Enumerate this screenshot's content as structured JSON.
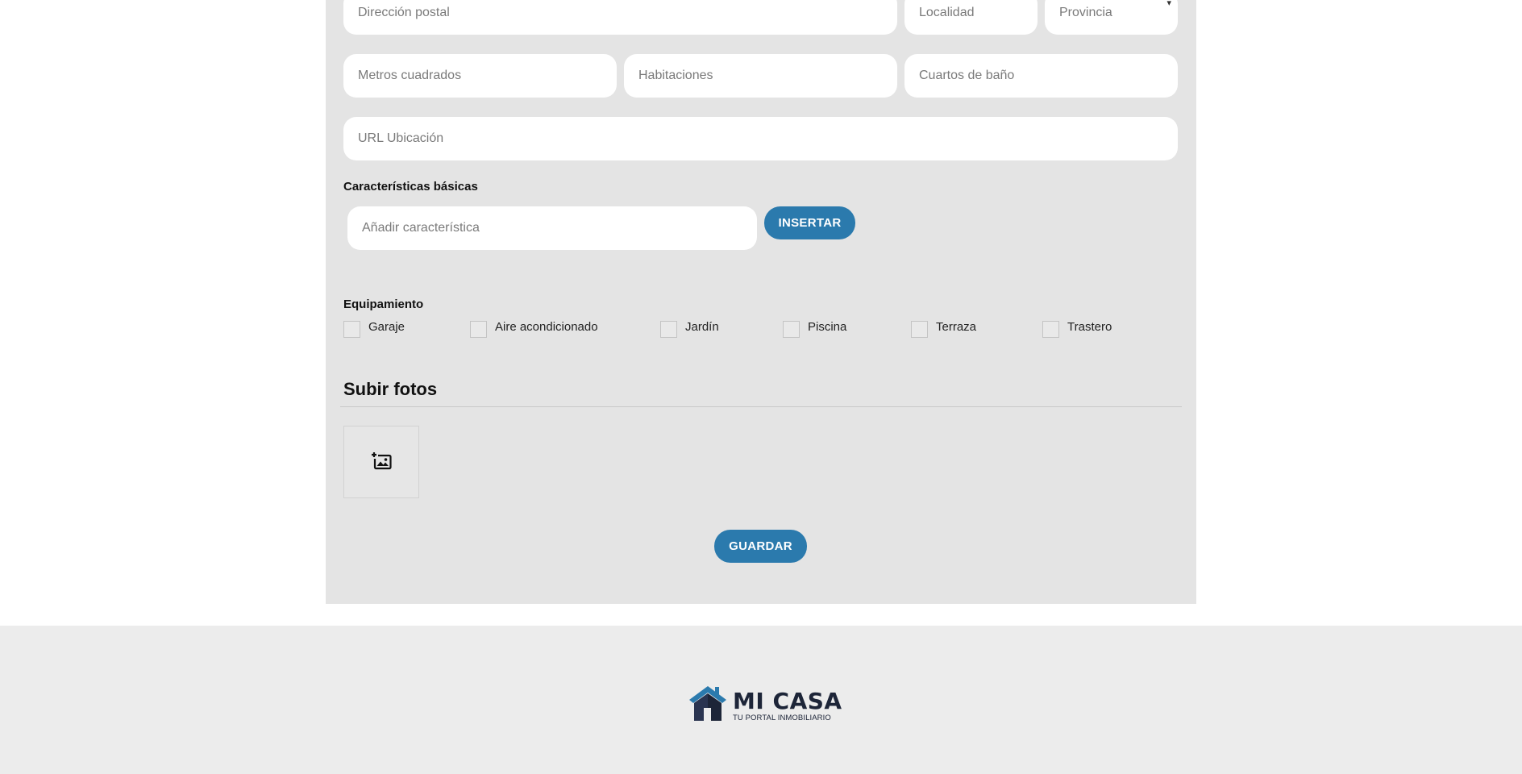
{
  "form": {
    "address": {
      "placeholder": "Dirección postal"
    },
    "locality": {
      "placeholder": "Localidad"
    },
    "province": {
      "selected": "Provincia",
      "caret": "▾"
    },
    "square_meters": {
      "placeholder": "Metros cuadrados"
    },
    "rooms": {
      "placeholder": "Habitaciones"
    },
    "bathrooms": {
      "placeholder": "Cuartos de baño"
    },
    "location_url": {
      "placeholder": "URL Ubicación"
    }
  },
  "features": {
    "title": "Características básicas",
    "input_placeholder": "Añadir característica",
    "insert_label": "INSERTAR"
  },
  "equipment": {
    "title": "Equipamiento",
    "items": [
      "Garaje",
      "Aire acondicionado",
      "Jardín",
      "Piscina",
      "Terraza",
      "Trastero"
    ]
  },
  "photos": {
    "title": "Subir fotos",
    "add_icon": "add-photo-icon"
  },
  "save_label": "GUARDAR",
  "footer": {
    "logo_name": "MI CASA",
    "logo_tagline": "TU PORTAL INMOBILIARIO"
  },
  "colors": {
    "accent": "#2b7aad",
    "panel": "#e4e4e4",
    "footer": "#ececec",
    "logo_dark": "#1d2538"
  }
}
